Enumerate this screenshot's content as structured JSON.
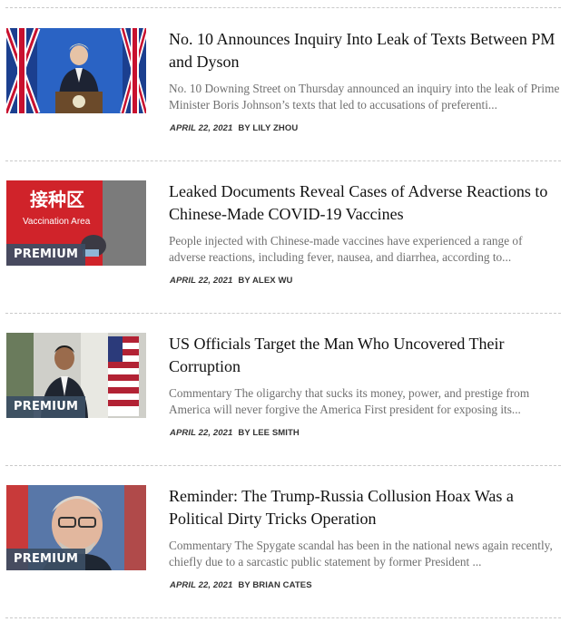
{
  "articles": [
    {
      "title": "No. 10 Announces Inquiry Into Leak of Texts Between PM and Dyson",
      "excerpt": "No. 10 Downing Street on Thursday announced an inquiry into the leak of Prime Minister Boris Johnson’s texts that led to accusations of preferenti...",
      "date": "APRIL 22, 2021",
      "byline": "BY LILY ZHOU",
      "badge": "",
      "thumb_icon": "podium-flags-image"
    },
    {
      "title": "Leaked Documents Reveal Cases of Adverse Reactions to Chinese-Made COVID-19 Vaccines",
      "excerpt": "People injected with Chinese-made vaccines have experienced a range of adverse reactions, including fever, nausea, and diarrhea, according to...",
      "date": "APRIL 22, 2021",
      "byline": "BY ALEX WU",
      "badge": "PREMIUM",
      "thumb_sign_zh": "接种区",
      "thumb_sign_en": "Vaccination Area",
      "thumb_icon": "vaccination-area-image"
    },
    {
      "title": "US Officials Target the Man Who Uncovered Their Corruption",
      "excerpt": "Commentary The oligarchy that sucks its money, power, and prestige from America will never forgive the America First president for exposing its...",
      "date": "APRIL 22, 2021",
      "byline": "BY LEE SMITH",
      "badge": "PREMIUM",
      "thumb_icon": "man-with-flag-image"
    },
    {
      "title": "Reminder: The Trump-Russia Collusion Hoax Was a Political Dirty Tricks Operation",
      "excerpt": "Commentary The Spygate scandal has been in the national news again recently, chiefly due to a sarcastic public statement by former President ...",
      "date": "APRIL 22, 2021",
      "byline": "BY BRIAN CATES",
      "badge": "PREMIUM",
      "thumb_icon": "portrait-image"
    }
  ]
}
